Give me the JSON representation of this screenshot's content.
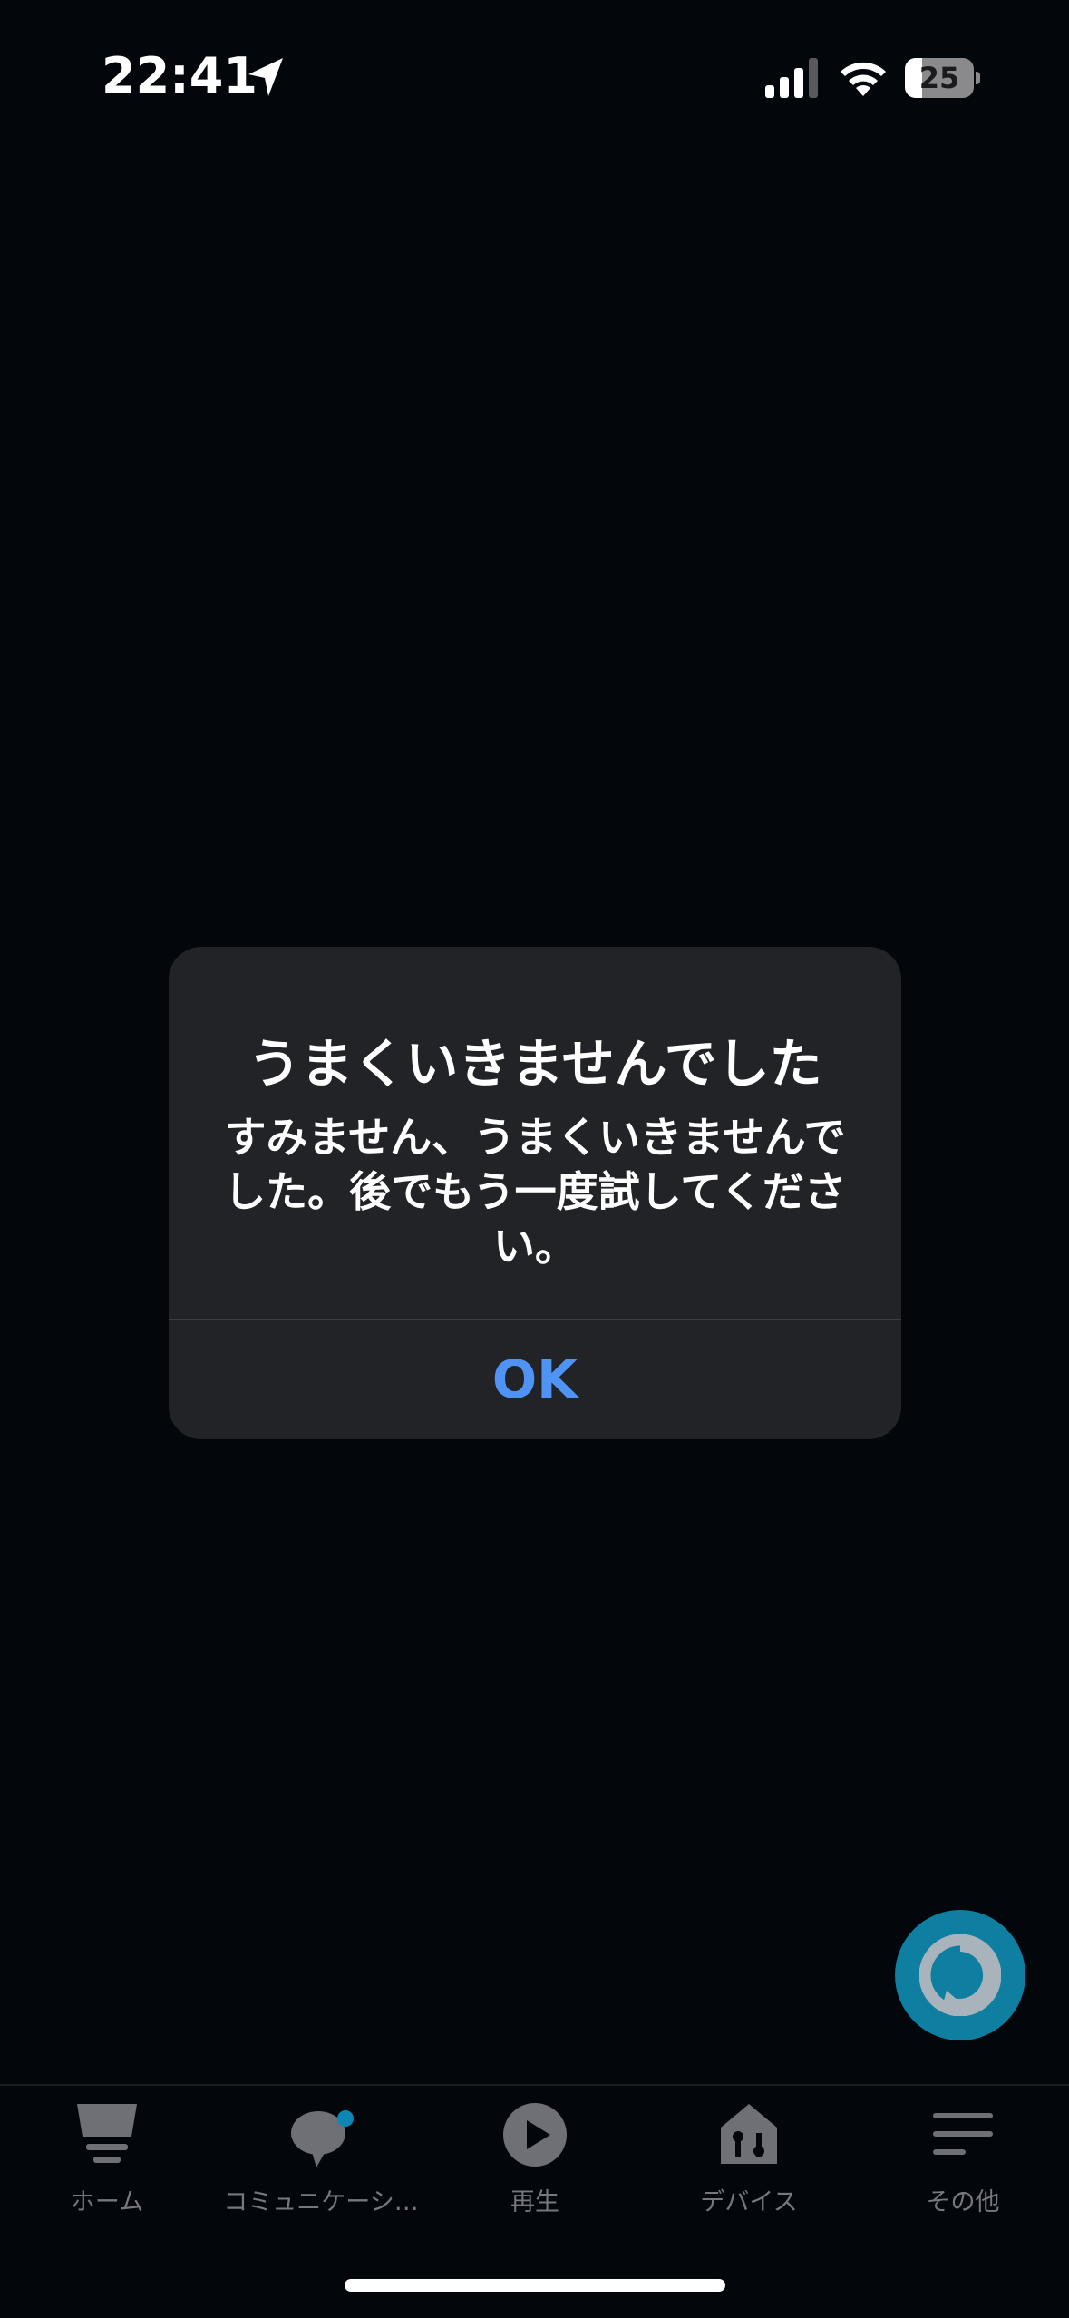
{
  "status_bar": {
    "time": "22:41",
    "battery_level": "25",
    "battery_fraction": 0.25
  },
  "alert": {
    "title": "うまくいきませんでした",
    "message": "すみません、うまくいきませんでした。後でもう一度試してください。",
    "ok_label": "OK"
  },
  "tabs": [
    {
      "label": "ホーム",
      "icon": "home-icon"
    },
    {
      "label": "コミュニケーシ…",
      "icon": "chat-icon"
    },
    {
      "label": "再生",
      "icon": "play-icon"
    },
    {
      "label": "デバイス",
      "icon": "devices-icon"
    },
    {
      "label": "その他",
      "icon": "menu-icon"
    }
  ],
  "colors": {
    "background": "#03060b",
    "alert_background": "#222326",
    "ok_blue": "#4f93f5",
    "alexa_teal": "#0e7fa0",
    "tab_inactive": "#76787d",
    "notification_dot": "#0e86b3"
  }
}
